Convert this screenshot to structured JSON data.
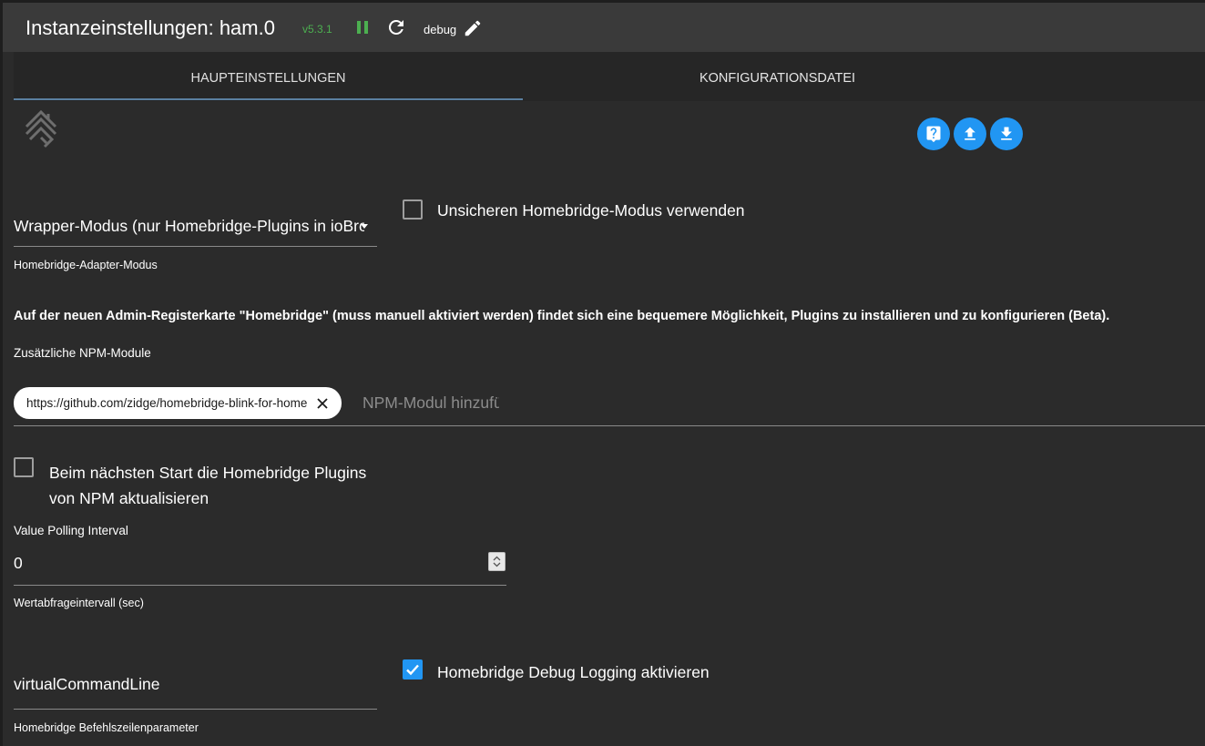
{
  "header": {
    "title": "Instanzeinstellungen: ham.0",
    "version": "v5.3.1",
    "log_level": "debug",
    "status_color": "#4caf50"
  },
  "tabs": [
    {
      "label": "HAUPTEINSTELLUNGEN",
      "active": true
    },
    {
      "label": "KONFIGURATIONSDATEI",
      "active": false
    }
  ],
  "actions": {
    "help_icon": "help-icon",
    "upload_icon": "upload-icon",
    "download_icon": "download-icon",
    "accent": "#2196f3"
  },
  "form": {
    "mode": {
      "value": "Wrapper-Modus (nur Homebridge-Plugins in ioBroker)",
      "helper": "Homebridge-Adapter-Modus"
    },
    "unsafe_mode": {
      "label": "Unsicheren Homebridge-Modus verwenden",
      "checked": false
    },
    "info_text": "Auf der neuen Admin-Registerkarte \"Homebridge\" (muss manuell aktiviert werden) findet sich eine bequemere Möglichkeit, Plugins zu installieren und zu konfigurieren (Beta).",
    "npm_modules": {
      "label": "Zusätzliche NPM-Module",
      "chips": [
        "https://github.com/zidge/homebridge-blink-for-home"
      ],
      "placeholder": "NPM-Modul hinzufügen"
    },
    "update_plugins": {
      "label": "Beim nächsten Start die Homebridge Plugins von NPM aktualisieren",
      "checked": false
    },
    "polling": {
      "label": "Value Polling Interval",
      "value": "0",
      "helper": "Wertabfrageintervall (sec)"
    },
    "command_line": {
      "value": "virtualCommandLine",
      "helper": "Homebridge Befehlszeilenparameter"
    },
    "debug_logging": {
      "label": "Homebridge Debug Logging aktivieren",
      "checked": true
    }
  }
}
